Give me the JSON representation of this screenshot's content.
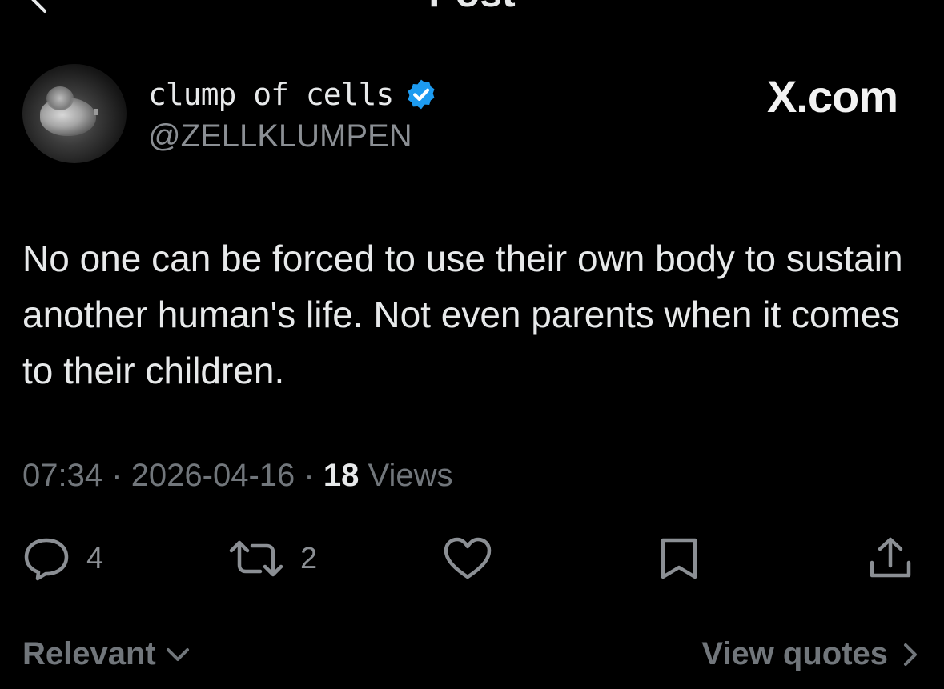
{
  "header": {
    "title": "Post"
  },
  "author": {
    "display_name": "clump of cells",
    "handle": "@ZELLKLUMPEN",
    "verified_color": "#1d9bf0"
  },
  "brand": "X.com",
  "tweet": {
    "text": "No one can be forced to use their own body to sustain another human's life. Not even parents when it comes to their children."
  },
  "meta": {
    "time": "07:34",
    "separator": "·",
    "date": "2026-04-16",
    "views_count": "18",
    "views_label": "Views"
  },
  "actions": {
    "replies": "4",
    "reposts": "2"
  },
  "footer": {
    "sort_label": "Relevant",
    "view_quotes_label": "View quotes"
  },
  "colors": {
    "background": "#000000",
    "text": "#e7e9ea",
    "muted": "#71767b",
    "accent": "#1d9bf0"
  },
  "icons": {
    "back": "chevron-left-icon",
    "verified": "verified-badge-icon",
    "reply": "speech-bubble-icon",
    "repost": "repost-arrows-icon",
    "like": "heart-icon",
    "bookmark": "bookmark-icon",
    "share": "share-upload-icon",
    "sort": "chevron-down-icon",
    "quotes": "chevron-right-icon"
  }
}
